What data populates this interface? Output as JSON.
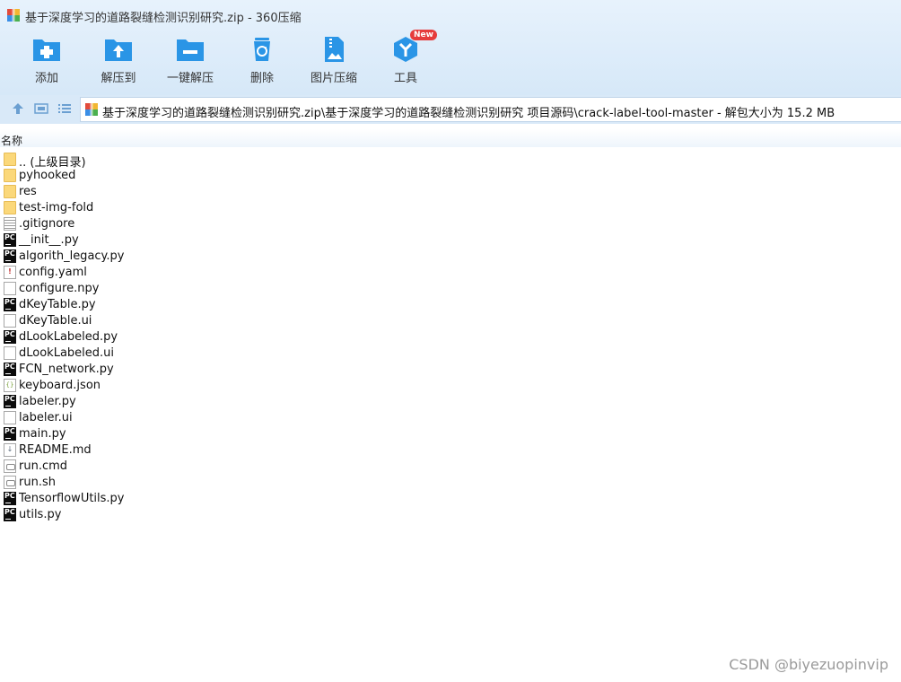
{
  "window": {
    "title": "基于深度学习的道路裂缝检测识别研究.zip - 360压缩"
  },
  "toolbar": {
    "add_label": "添加",
    "extract_to_label": "解压到",
    "one_click_extract_label": "一键解压",
    "delete_label": "删除",
    "image_compress_label": "图片压缩",
    "tools_label": "工具",
    "tools_badge": "New"
  },
  "address": {
    "path": "基于深度学习的道路裂缝检测识别研究.zip\\基于深度学习的道路裂缝检测识别研究 项目源码\\crack-label-tool-master - 解包大小为 15.2 MB"
  },
  "list": {
    "column_name": "名称",
    "items": [
      {
        "name": ".. (上级目录)",
        "icon": "folder-icon"
      },
      {
        "name": "pyhooked",
        "icon": "folder-icon"
      },
      {
        "name": "res",
        "icon": "folder-icon"
      },
      {
        "name": "test-img-fold",
        "icon": "folder-icon"
      },
      {
        "name": ".gitignore",
        "icon": "text-file-icon"
      },
      {
        "name": "__init__.py",
        "icon": "pycharm-file-icon"
      },
      {
        "name": "algorith_legacy.py",
        "icon": "pycharm-file-icon"
      },
      {
        "name": "config.yaml",
        "icon": "yaml-file-icon"
      },
      {
        "name": "configure.npy",
        "icon": "blank-file-icon"
      },
      {
        "name": "dKeyTable.py",
        "icon": "pycharm-file-icon"
      },
      {
        "name": "dKeyTable.ui",
        "icon": "blank-file-icon"
      },
      {
        "name": "dLookLabeled.py",
        "icon": "pycharm-file-icon"
      },
      {
        "name": "dLookLabeled.ui",
        "icon": "blank-file-icon"
      },
      {
        "name": "FCN_network.py",
        "icon": "pycharm-file-icon"
      },
      {
        "name": "keyboard.json",
        "icon": "json-file-icon"
      },
      {
        "name": "labeler.py",
        "icon": "pycharm-file-icon"
      },
      {
        "name": "labeler.ui",
        "icon": "blank-file-icon"
      },
      {
        "name": "main.py",
        "icon": "pycharm-file-icon"
      },
      {
        "name": "README.md",
        "icon": "markdown-file-icon"
      },
      {
        "name": "run.cmd",
        "icon": "script-file-icon"
      },
      {
        "name": "run.sh",
        "icon": "script-file-icon"
      },
      {
        "name": "TensorflowUtils.py",
        "icon": "pycharm-file-icon"
      },
      {
        "name": "utils.py",
        "icon": "pycharm-file-icon"
      }
    ]
  },
  "watermark": "CSDN @biyezuopinvip",
  "colors": {
    "toolbar_blue": "#2a95e6",
    "header_bg": "#dcebf9",
    "folder_yellow": "#fbd87a",
    "badge_red": "#e63c3c"
  }
}
